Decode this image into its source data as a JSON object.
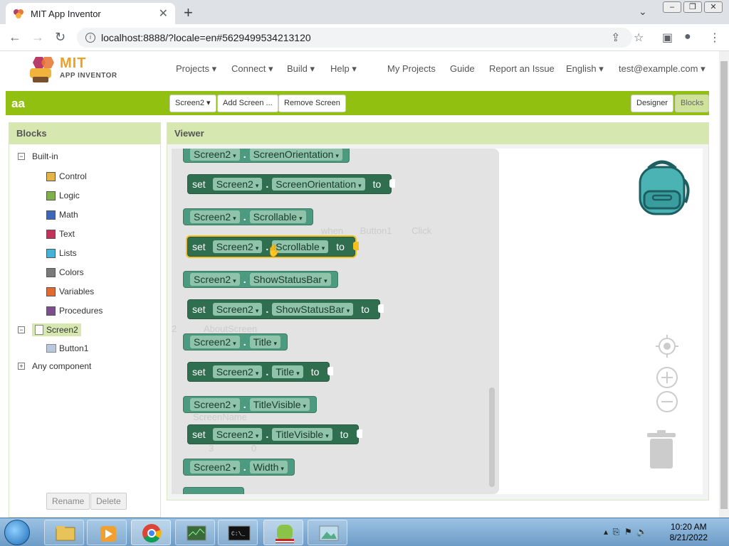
{
  "browser": {
    "tab_title": "MIT App Inventor",
    "tab_close": "✕",
    "new_tab": "+",
    "url": "localhost:8888/?locale=en#5629499534213120"
  },
  "app": {
    "logo_line1": "MIT",
    "logo_line2": "APP INVENTOR",
    "nav": [
      "Projects ▾",
      "Connect ▾",
      "Build ▾",
      "Help ▾",
      "My Projects",
      "Guide",
      "Report an Issue",
      "English ▾",
      "test@example.com ▾"
    ]
  },
  "toolbar": {
    "project_name": "aa",
    "screen_select": "Screen2 ▾",
    "add_screen": "Add Screen ...",
    "remove_screen": "Remove Screen",
    "designer": "Designer",
    "blocks": "Blocks"
  },
  "blocks_panel": {
    "title": "Blocks",
    "builtin": "Built-in",
    "items": [
      {
        "label": "Control",
        "color": "#e3b447"
      },
      {
        "label": "Logic",
        "color": "#7fb14a"
      },
      {
        "label": "Math",
        "color": "#3e66b8"
      },
      {
        "label": "Text",
        "color": "#c2335a"
      },
      {
        "label": "Lists",
        "color": "#45b2d8"
      },
      {
        "label": "Colors",
        "color": "#7a7a7a"
      },
      {
        "label": "Variables",
        "color": "#e06a2f"
      },
      {
        "label": "Procedures",
        "color": "#7a4f8c"
      }
    ],
    "screen": "Screen2",
    "component": "Button1",
    "any_component": "Any component",
    "rename": "Rename",
    "delete": "Delete"
  },
  "viewer": {
    "title": "Viewer",
    "set": "set",
    "to": "to",
    "screen": "Screen2",
    "props": [
      "ScreenOrientation",
      "Scrollable",
      "ShowStatusBar",
      "Title",
      "TitleVisible",
      "Width"
    ],
    "ghost_when": "when",
    "ghost_button": "Button1",
    "ghost_click": "Click",
    "ghost_about": "AboutScreen",
    "ghost_screenname": "ScreenName",
    "ghost_warn": "3",
    "ghost_err": "0",
    "ghost_2": "2"
  },
  "taskbar": {
    "time": "10:20 AM",
    "date": "8/21/2022"
  }
}
